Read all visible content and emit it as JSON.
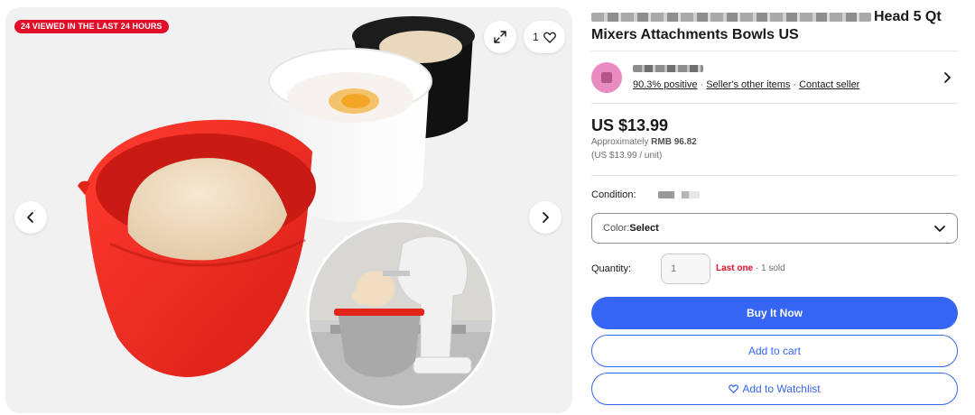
{
  "gallery": {
    "badge": "24 VIEWED IN THE LAST 24 HOURS",
    "watch_count": "1",
    "colors": {
      "badge": "#e0102a",
      "bowl_red": "#ee2f26",
      "dough": "#efdcc1"
    }
  },
  "listing": {
    "title_visible": "Head 5 Qt Mixers Attachments Bowls US",
    "title_line1_end": "Head 5 Qt",
    "title_line2": "Mixers Attachments Bowls US"
  },
  "seller": {
    "feedback": "90.3% positive",
    "other_items": "Seller's other items",
    "contact": "Contact seller"
  },
  "price": {
    "main": "US $13.99",
    "approx_prefix": "Approximately ",
    "approx_value": "RMB 96.82",
    "unit": "(US $13.99 / unit)"
  },
  "condition": {
    "label": "Condition:"
  },
  "color_select": {
    "label": "Color: ",
    "value": "Select"
  },
  "quantity": {
    "label": "Quantity:",
    "placeholder": "1",
    "last": "Last one",
    "sold": " · 1 sold"
  },
  "actions": {
    "buy": "Buy It Now",
    "cart": "Add to cart",
    "watch": "Add to Watchlist"
  },
  "theme": {
    "primary": "#3665f3",
    "text": "#191919",
    "muted": "#707070"
  }
}
